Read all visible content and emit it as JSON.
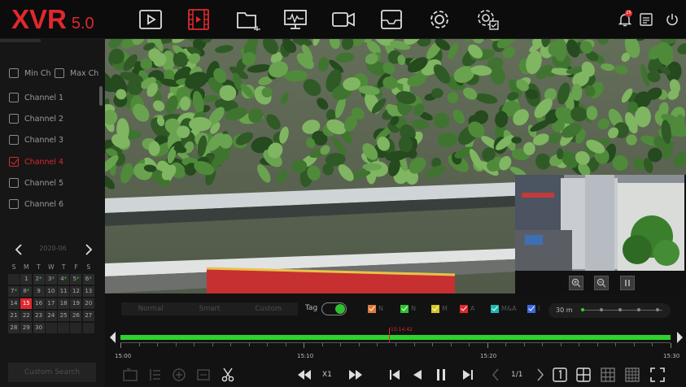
{
  "app": {
    "logo": "XVR",
    "version": "5.0"
  },
  "alarm": {
    "count": "25"
  },
  "sidebar": {
    "min_ch": "Min Ch",
    "max_ch": "Max Ch",
    "channels": [
      {
        "label": "Channel 1",
        "checked": false
      },
      {
        "label": "Channel 2",
        "checked": false
      },
      {
        "label": "Channel 3",
        "checked": false
      },
      {
        "label": "Channel 4",
        "checked": true
      },
      {
        "label": "Channel 5",
        "checked": false
      },
      {
        "label": "Channel 6",
        "checked": false
      }
    ],
    "calendar": {
      "month": "2020-06",
      "weekdays": [
        "S",
        "M",
        "T",
        "W",
        "T",
        "F",
        "S"
      ],
      "weeks": [
        [
          "",
          "1",
          "2",
          "3",
          "4",
          "5",
          "6"
        ],
        [
          "7",
          "8",
          "9",
          "10",
          "11",
          "12",
          "13"
        ],
        [
          "14",
          "15",
          "16",
          "17",
          "18",
          "19",
          "20"
        ],
        [
          "21",
          "22",
          "23",
          "24",
          "25",
          "26",
          "27"
        ],
        [
          "28",
          "29",
          "30",
          "",
          "",
          "",
          ""
        ]
      ],
      "recorded_days": [
        "2",
        "3",
        "4",
        "5",
        "6",
        "7",
        "8"
      ],
      "selected_day": "15"
    },
    "custom_search": "Custom Search"
  },
  "modes": [
    "Normal",
    "Smart",
    "Custom"
  ],
  "tag": {
    "label": "Tag",
    "on": true
  },
  "filters": [
    {
      "label": "N",
      "color": "#e07a3a"
    },
    {
      "label": "N",
      "color": "#2fbf2f"
    },
    {
      "label": "M",
      "color": "#d6c623"
    },
    {
      "label": "A",
      "color": "#e0282e"
    },
    {
      "label": "M&A",
      "color": "#1fb5b5"
    },
    {
      "label": "I",
      "color": "#3a6ae0"
    }
  ],
  "zoom": {
    "label": "30 m"
  },
  "timeline": {
    "cursor_time": "15:14:42",
    "labels": [
      "15:00",
      "15:10",
      "15:20",
      "15:30"
    ]
  },
  "playback": {
    "speed": "X1",
    "page": "1/1"
  },
  "colors": {
    "accent": "#e0282e",
    "record": "#2fd12f"
  }
}
